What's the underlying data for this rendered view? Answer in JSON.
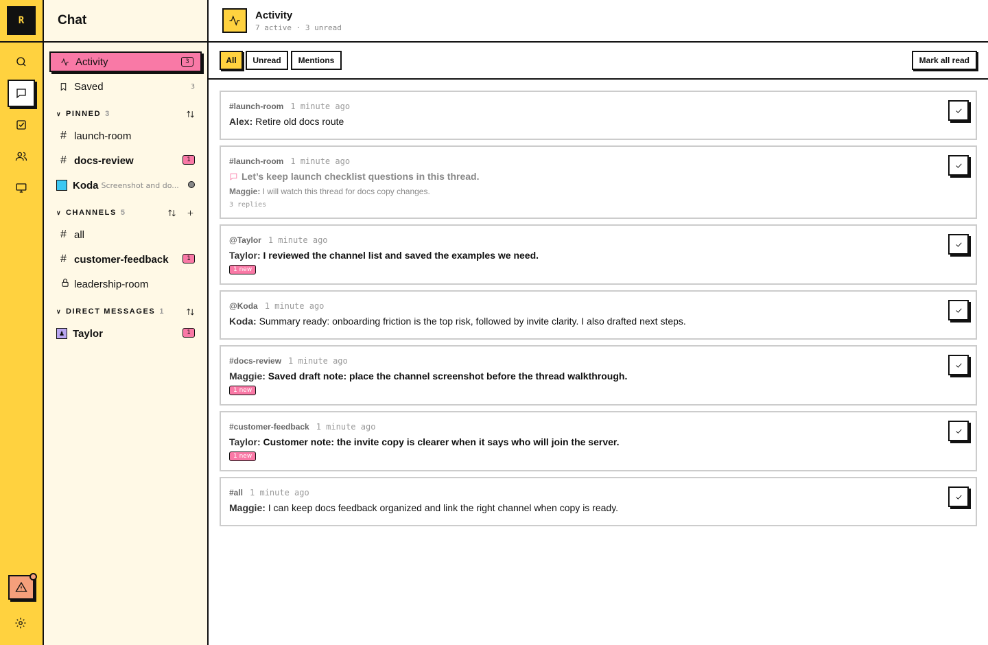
{
  "rail": {
    "logo": "R",
    "items": [
      "search-icon",
      "chat-icon",
      "tasks-icon",
      "people-icon",
      "monitor-icon"
    ],
    "active": "chat-icon"
  },
  "sidebar": {
    "title": "Chat",
    "activity": {
      "label": "Activity",
      "count": "3"
    },
    "saved": {
      "label": "Saved",
      "count": "3"
    },
    "pinned": {
      "header": "PINNED",
      "count": "3",
      "items": [
        {
          "label": "launch-room",
          "badge": ""
        },
        {
          "label": "docs-review",
          "badge": "1"
        },
        {
          "label": "Koda",
          "sub": "Screenshot and do..."
        }
      ]
    },
    "channels": {
      "header": "CHANNELS",
      "count": "5",
      "items": [
        {
          "label": "all",
          "badge": ""
        },
        {
          "label": "customer-feedback",
          "badge": "1"
        },
        {
          "label": "leadership-room",
          "badge": ""
        }
      ]
    },
    "dms": {
      "header": "DIRECT MESSAGES",
      "count": "1",
      "items": [
        {
          "label": "Taylor",
          "badge": "1"
        }
      ]
    }
  },
  "main": {
    "title": "Activity",
    "subtitle": "7 active · 3 unread",
    "filters": [
      "All",
      "Unread",
      "Mentions"
    ],
    "active_filter": "All",
    "mark_all": "Mark all read",
    "cards": [
      {
        "source": "#launch-room",
        "time": "1 minute ago",
        "author": "Alex:",
        "text": "Retire old docs route"
      },
      {
        "source": "#launch-room",
        "time": "1 minute ago",
        "thread": "Let’s keep launch checklist questions in this thread.",
        "reply_author": "Maggie:",
        "reply_text": "I will watch this thread for docs copy changes.",
        "replies": "3 replies"
      },
      {
        "source": "@Taylor",
        "time": "1 minute ago",
        "author": "Taylor:",
        "text": "I reviewed the channel list and saved the examples we need.",
        "new": "1 new"
      },
      {
        "source": "@Koda",
        "time": "1 minute ago",
        "author": "Koda:",
        "text": "Summary ready: onboarding friction is the top risk, followed by invite clarity. I also drafted next steps."
      },
      {
        "source": "#docs-review",
        "time": "1 minute ago",
        "author": "Maggie:",
        "text": "Saved draft note: place the channel screenshot before the thread walkthrough.",
        "new": "1 new"
      },
      {
        "source": "#customer-feedback",
        "time": "1 minute ago",
        "author": "Taylor:",
        "text": "Customer note: the invite copy is clearer when it says who will join the server.",
        "new": "1 new"
      },
      {
        "source": "#all",
        "time": "1 minute ago",
        "author": "Maggie:",
        "text": "I can keep docs feedback organized and link the right channel when copy is ready."
      }
    ]
  },
  "colors": {
    "rail": "#ffd23f",
    "active": "#f979a6",
    "sidebar": "#fff9e6",
    "alert": "#f59f7b",
    "koda": "#3cc8f2",
    "taylor": "#b9a6f0"
  }
}
